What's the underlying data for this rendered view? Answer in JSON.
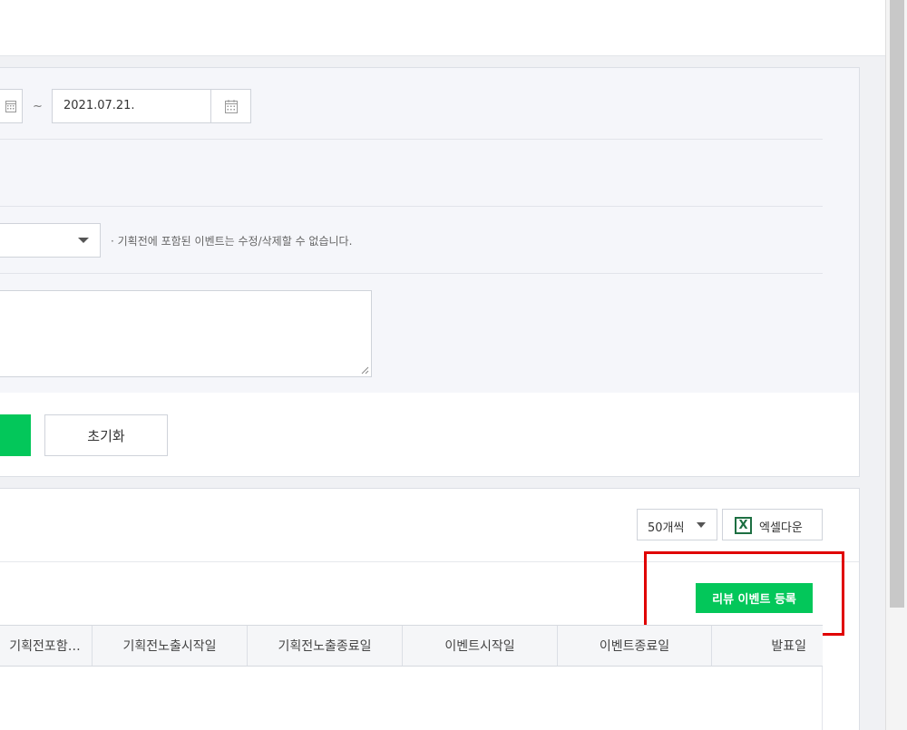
{
  "search": {
    "start_date": "",
    "end_date": "2021.07.21.",
    "tilde": "~",
    "select_value": "",
    "note": "· 기획전에 포함된 이벤트는 수정/삭제할 수 없습니다.",
    "memo_value": "",
    "search_label": "",
    "reset_label": "초기화"
  },
  "results": {
    "per_page": "50개씩",
    "excel_label": "엑셀다운",
    "register_label": "리뷰 이벤트 등록",
    "columns": [
      "기획전포함…",
      "기획전노출시작일",
      "기획전노출종료일",
      "이벤트시작일",
      "이벤트종료일",
      "발표일"
    ]
  },
  "colors": {
    "accent_green": "#03c75a",
    "highlight_red": "#e00000",
    "excel_green": "#1d6f42"
  },
  "icons": {
    "calendar": "calendar-icon",
    "dropdown": "chevron-down-icon",
    "excel": "excel-icon"
  }
}
